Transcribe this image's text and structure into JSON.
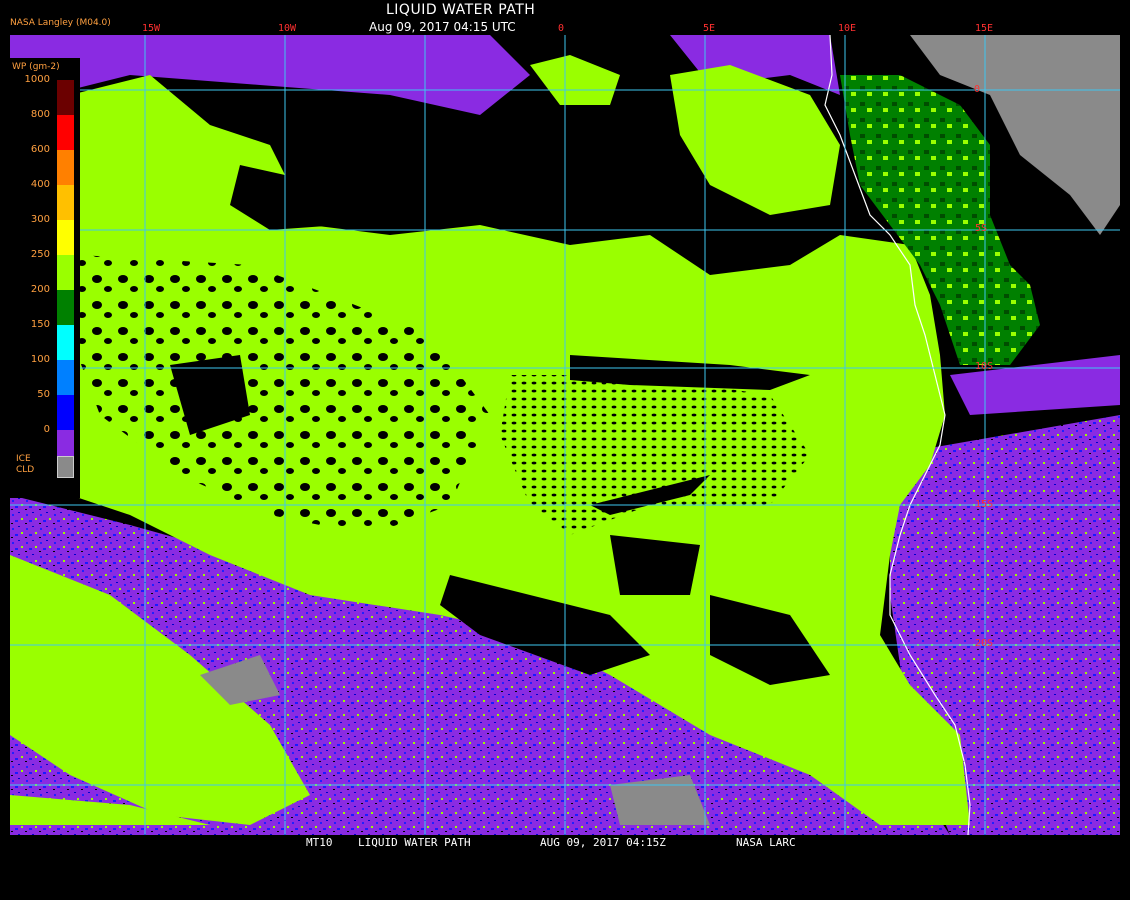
{
  "header": {
    "title": "LIQUID WATER PATH",
    "datetime": "Aug 09, 2017 04:15 UTC",
    "agency": "NASA Langley (M04.0)"
  },
  "map": {
    "lon_labels": [
      "15W",
      "10W",
      "0",
      "5E",
      "10E",
      "15E"
    ],
    "lat_labels": [
      "0",
      "5S",
      "10S",
      "15S",
      "20S"
    ],
    "gridline_color": "#3ec7f0",
    "coast_color": "#ffffff",
    "label_color": "#ff3030"
  },
  "legend": {
    "title": "WP (gm-2)",
    "ticks": [
      "1000",
      "800",
      "600",
      "400",
      "300",
      "250",
      "200",
      "150",
      "100",
      "50",
      "0"
    ],
    "ice_label_1": "ICE",
    "ice_label_2": "CLD",
    "colors": [
      "#6b0000",
      "#ff0000",
      "#ff8000",
      "#ffc000",
      "#ffff00",
      "#9aff00",
      "#008000",
      "#00ffff",
      "#0080ff",
      "#0000ff",
      "#8a2be2"
    ],
    "ice_color": "#8a8a8a"
  },
  "footer": {
    "product": "MT10",
    "title": "LIQUID WATER PATH",
    "datetime": "AUG 09, 2017 04:15Z",
    "agency": "NASA LARC"
  }
}
